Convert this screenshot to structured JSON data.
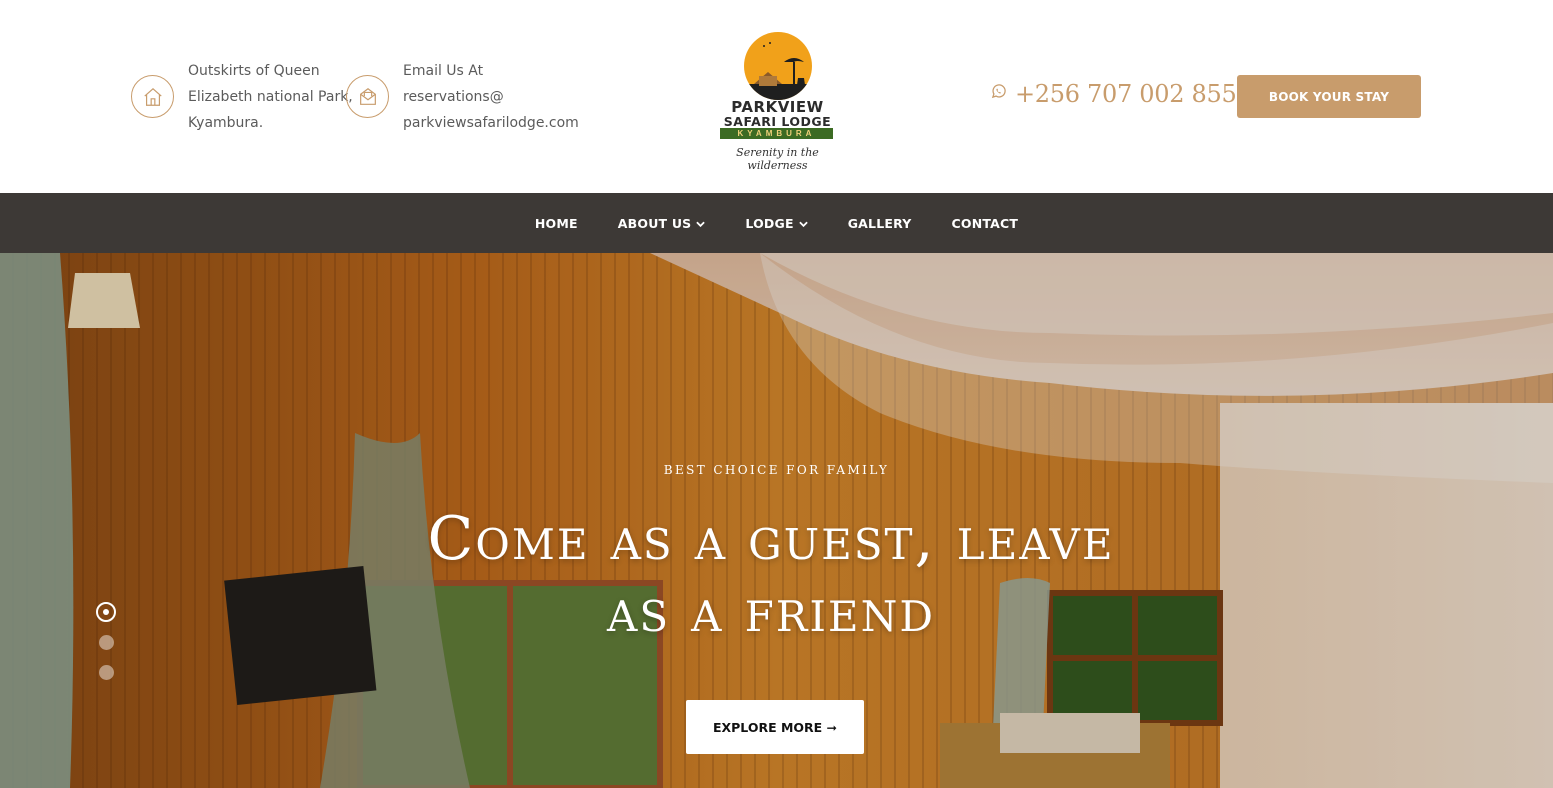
{
  "header": {
    "address": {
      "icon": "home-icon",
      "lines": [
        "Outskirts of Queen",
        "Elizabeth national Park,",
        "Kyambura."
      ]
    },
    "email": {
      "icon": "envelope-icon",
      "lines": [
        "Email Us At",
        "reservations@",
        "parkviewsafarilodge.com"
      ]
    },
    "logo": {
      "line1": "PARKVIEW",
      "line2": "SAFARI LODGE",
      "band": "KYAMBURA",
      "tagline": "Serenity in the wilderness"
    },
    "phone": {
      "icon": "whatsapp-icon",
      "number": "+256 707 002 855"
    },
    "book_button": "BOOK YOUR STAY"
  },
  "nav": {
    "items": [
      {
        "label": "HOME",
        "dropdown": false
      },
      {
        "label": "ABOUT US",
        "dropdown": true
      },
      {
        "label": "LODGE",
        "dropdown": true
      },
      {
        "label": "GALLERY",
        "dropdown": false
      },
      {
        "label": "CONTACT",
        "dropdown": false
      }
    ]
  },
  "hero": {
    "subtitle": "BEST CHOICE FOR FAMILY",
    "title_line1": "Come as a guest, leave",
    "title_line2": "as a friend",
    "cta": "EXPLORE MORE ➞",
    "slides": {
      "count": 3,
      "active": 1
    }
  },
  "colors": {
    "accent": "#c89c6c",
    "nav_bg": "#3d3936",
    "text": "#5b5b5b",
    "white": "#ffffff"
  }
}
